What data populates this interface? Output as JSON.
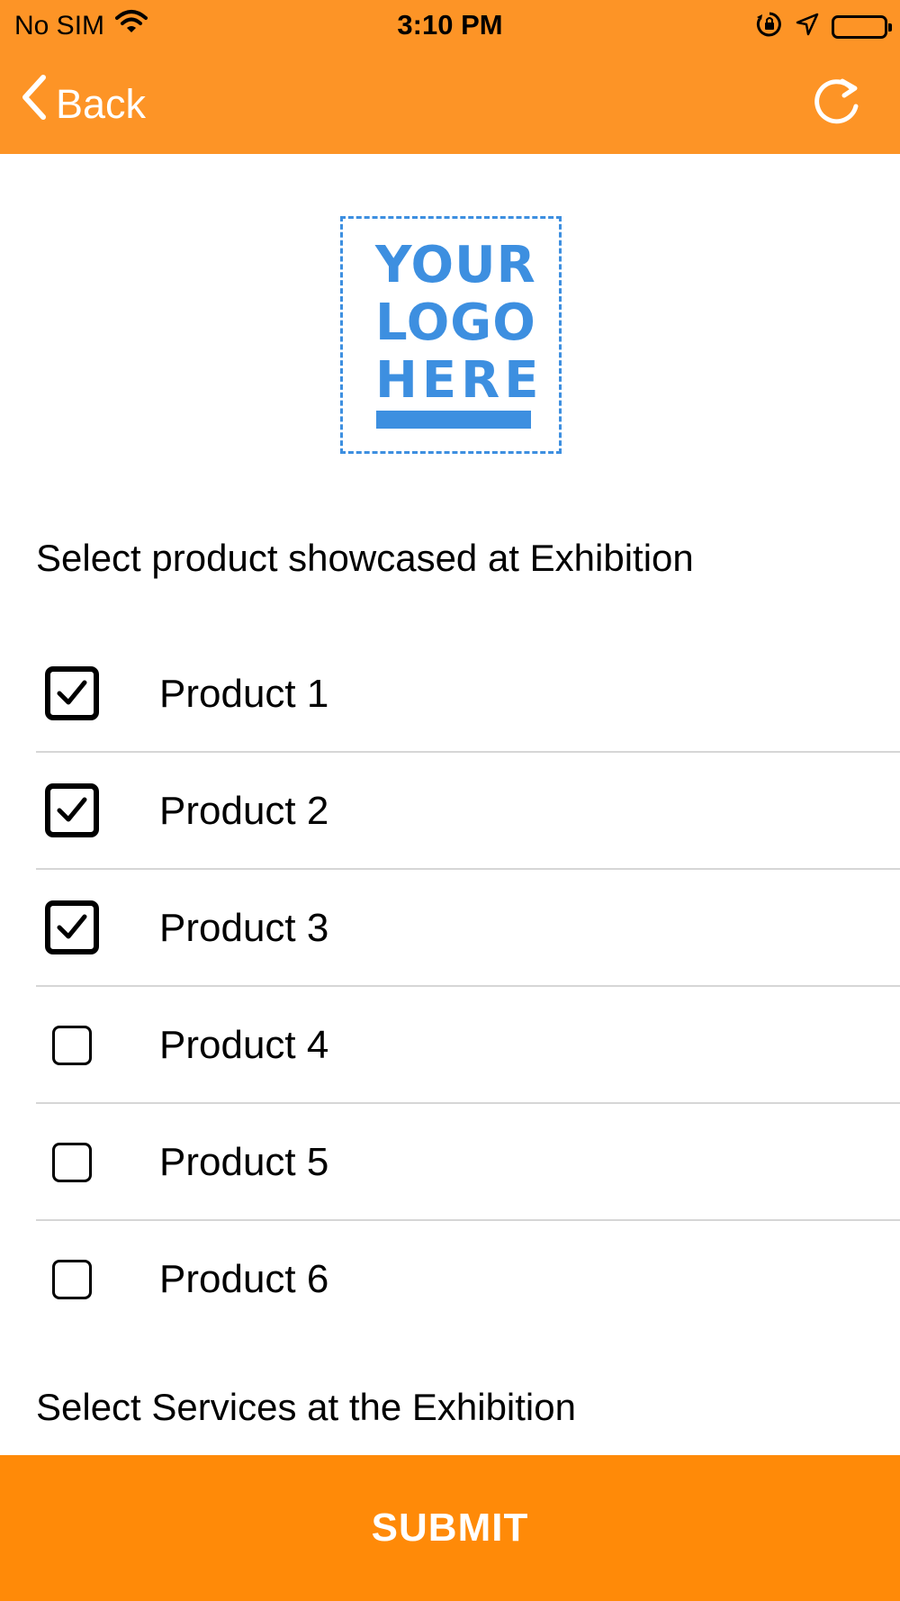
{
  "status_bar": {
    "carrier": "No SIM",
    "time": "3:10 PM",
    "icons": [
      "wifi-icon",
      "orientation-lock-icon",
      "location-arrow-icon",
      "battery-icon"
    ]
  },
  "nav": {
    "back_label": "Back",
    "refresh_icon": "refresh-icon"
  },
  "logo": {
    "lines": [
      "YOUR",
      "LOGO",
      "HERE"
    ]
  },
  "colors": {
    "header": "#fd9426",
    "submit": "#ff8a08",
    "logo": "#3d8fe0"
  },
  "products_section": {
    "title": "Select product showcased at Exhibition",
    "items": [
      {
        "label": "Product 1",
        "checked": true
      },
      {
        "label": "Product 2",
        "checked": true
      },
      {
        "label": "Product 3",
        "checked": true
      },
      {
        "label": "Product 4",
        "checked": false
      },
      {
        "label": "Product 5",
        "checked": false
      },
      {
        "label": "Product 6",
        "checked": false
      }
    ]
  },
  "services_section": {
    "title": "Select Services at the Exhibition"
  },
  "submit_label": "SUBMIT"
}
